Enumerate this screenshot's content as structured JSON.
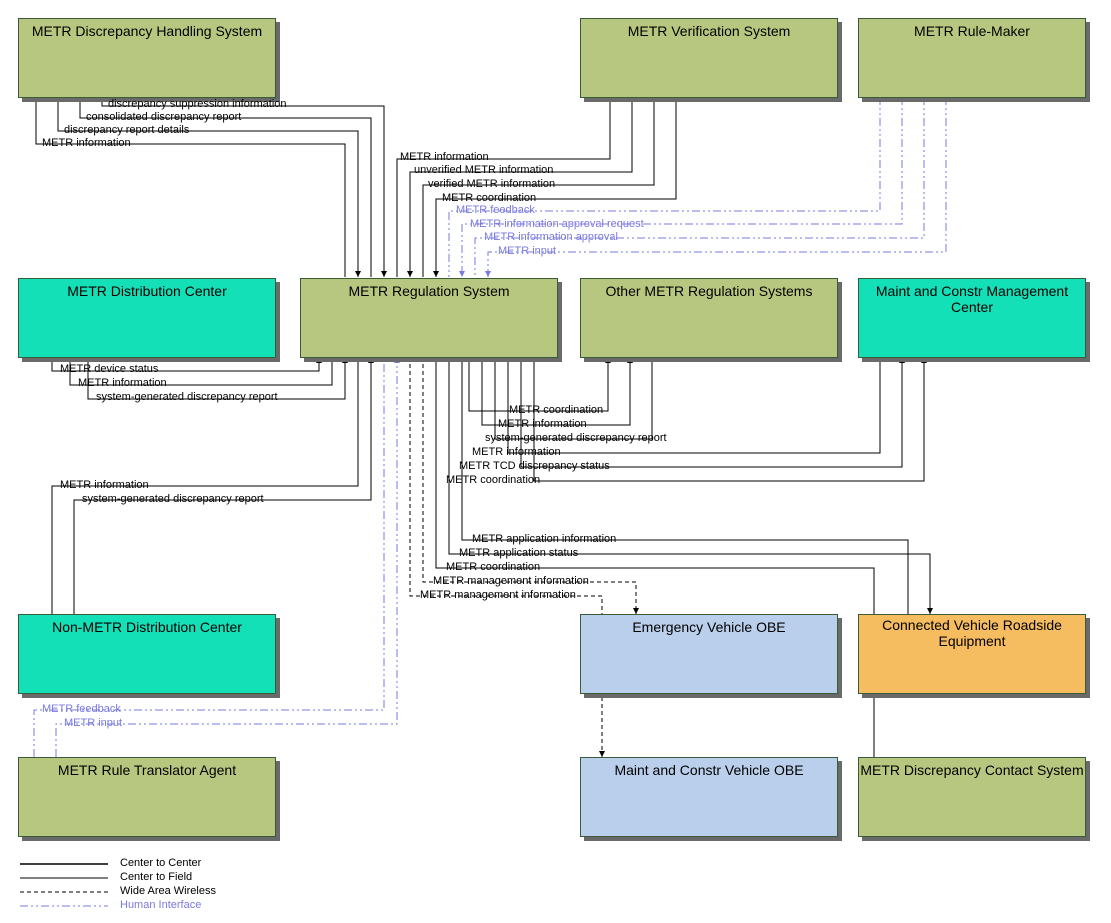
{
  "boxes": {
    "discrepancy_handling": "METR Discrepancy Handling System",
    "verification": "METR Verification System",
    "rule_maker": "METR Rule-Maker",
    "distribution_center": "METR Distribution Center",
    "regulation": "METR Regulation System",
    "other_regulation": "Other METR Regulation Systems",
    "maint_mgmt": "Maint and Constr Management Center",
    "non_metr_dist": "Non-METR Distribution Center",
    "emergency_obe": "Emergency Vehicle OBE",
    "cv_roadside": "Connected Vehicle Roadside Equipment",
    "rule_translator": "METR Rule Translator Agent",
    "maint_vehicle_obe": "Maint and Constr Vehicle OBE",
    "discrepancy_contact": "METR Discrepancy Contact System"
  },
  "flows": {
    "dh_1": "discrepancy suppression information",
    "dh_2": "consolidated discrepancy report",
    "dh_3": "discrepancy report details",
    "dh_4": "METR information",
    "vs_1": "METR information",
    "vs_2": "unverified METR information",
    "vs_3": "verified METR information",
    "vs_4": "METR coordination",
    "rm_1": "METR feedback",
    "rm_2": "METR information approval request",
    "rm_3": "METR information approval",
    "rm_4": "METR input",
    "dc_1": "METR device status",
    "dc_2": "METR information",
    "dc_3": "system-generated discrepancy report",
    "or_1": "METR coordination",
    "or_2": "METR information",
    "or_3": "system-generated discrepancy report",
    "mm_1": "METR information",
    "mm_2": "METR TCD discrepancy status",
    "mm_3": "METR coordination",
    "nm_1": "METR information",
    "nm_2": "system-generated discrepancy report",
    "cv_1": "METR application information",
    "cv_2": "METR application status",
    "cv_3": "METR coordination",
    "ev_1": "METR management information",
    "mv_1": "METR management information",
    "rt_1": "METR feedback",
    "rt_2": "METR input"
  },
  "legend": {
    "c2c": "Center to Center",
    "c2f": "Center to Field",
    "waw": "Wide Area Wireless",
    "hi": "Human Interface"
  },
  "colors": {
    "olive": "#b8c77f",
    "teal": "#14e0b8",
    "blue": "#bacfeb",
    "orange": "#f5bc60",
    "hi_line": "#7a7ae0"
  }
}
